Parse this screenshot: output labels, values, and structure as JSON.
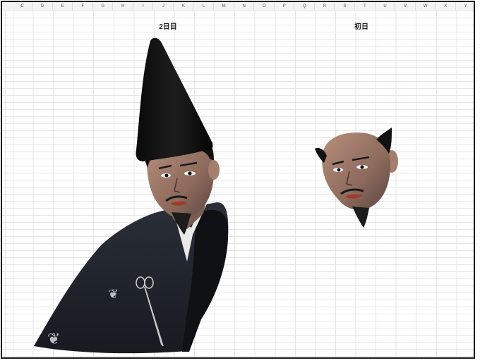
{
  "sheet": {
    "columns": [
      "C",
      "D",
      "E",
      "F",
      "G",
      "H",
      "I",
      "J",
      "K",
      "L",
      "M",
      "N",
      "O",
      "P",
      "Q",
      "R",
      "S",
      "T",
      "U",
      "V",
      "W",
      "X",
      "Y"
    ]
  },
  "labels": {
    "left": "2日目",
    "right": "初日"
  },
  "drawings": {
    "left": "portrait-with-eboshi-hat-and-black-robe",
    "right": "portrait-head-only"
  }
}
